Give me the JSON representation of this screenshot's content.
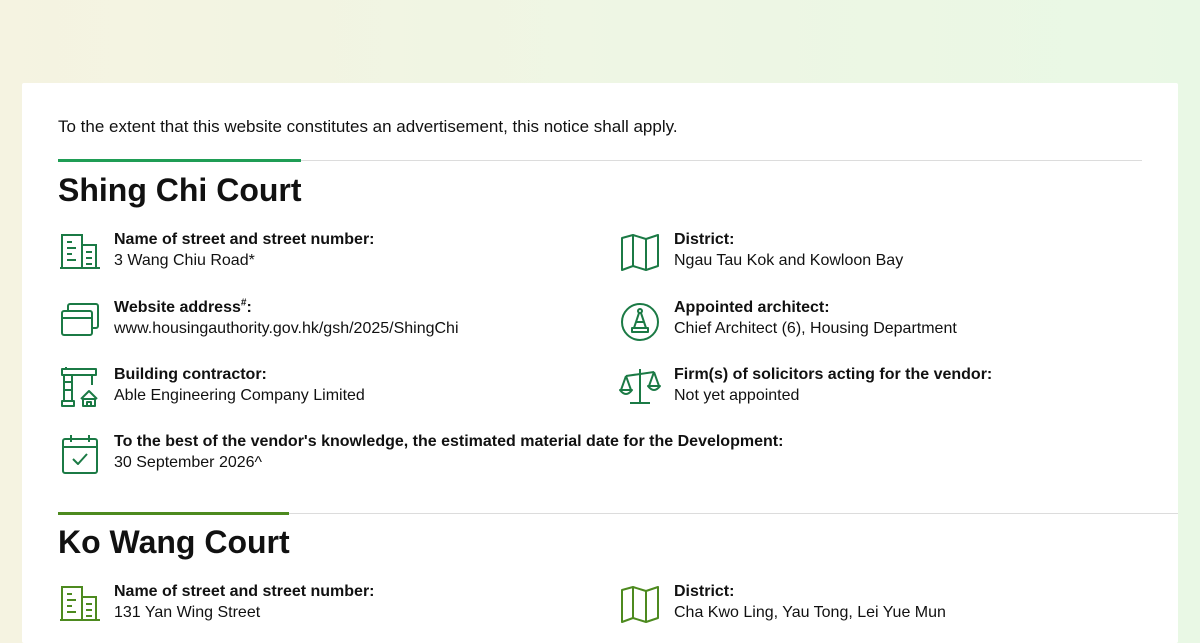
{
  "notice": "To the extent that this website constitutes an advertisement, this notice shall apply.",
  "colors": {
    "shing_chi_accent": "#1f9d55",
    "ko_wang_accent": "#4d8a1f",
    "icon_green": "#1b7a45",
    "icon_olive": "#4d8a1f"
  },
  "shing_chi": {
    "title": "Shing Chi Court",
    "street_label": "Name of street and street number:",
    "street_value": "3 Wang Chiu Road*",
    "district_label": "District:",
    "district_value": "Ngau Tau Kok and Kowloon Bay",
    "website_label": "Website address",
    "website_sup": "#",
    "website_colon": ":",
    "website_value": "www.housingauthority.gov.hk/gsh/2025/ShingChi",
    "architect_label": "Appointed architect:",
    "architect_value": "Chief Architect (6), Housing Department",
    "contractor_label": "Building contractor:",
    "contractor_value": "Able Engineering Company Limited",
    "solicitors_label": "Firm(s) of solicitors acting for the vendor:",
    "solicitors_value": "Not yet appointed",
    "material_date_label": "To the best of the vendor's knowledge, the estimated material date for the Development:",
    "material_date_value": "30 September 2026^"
  },
  "ko_wang": {
    "title": "Ko Wang Court",
    "street_label": "Name of street and street number:",
    "street_value": "131 Yan Wing Street",
    "district_label": "District:",
    "district_value": "Cha Kwo Ling, Yau Tong, Lei Yue Mun"
  },
  "icons": {
    "building": "building-icon",
    "map": "map-icon",
    "browser": "browser-windows-icon",
    "architect": "drafting-compass-icon",
    "crane": "construction-crane-icon",
    "scales": "scales-of-justice-icon",
    "calendar": "calendar-check-icon"
  }
}
